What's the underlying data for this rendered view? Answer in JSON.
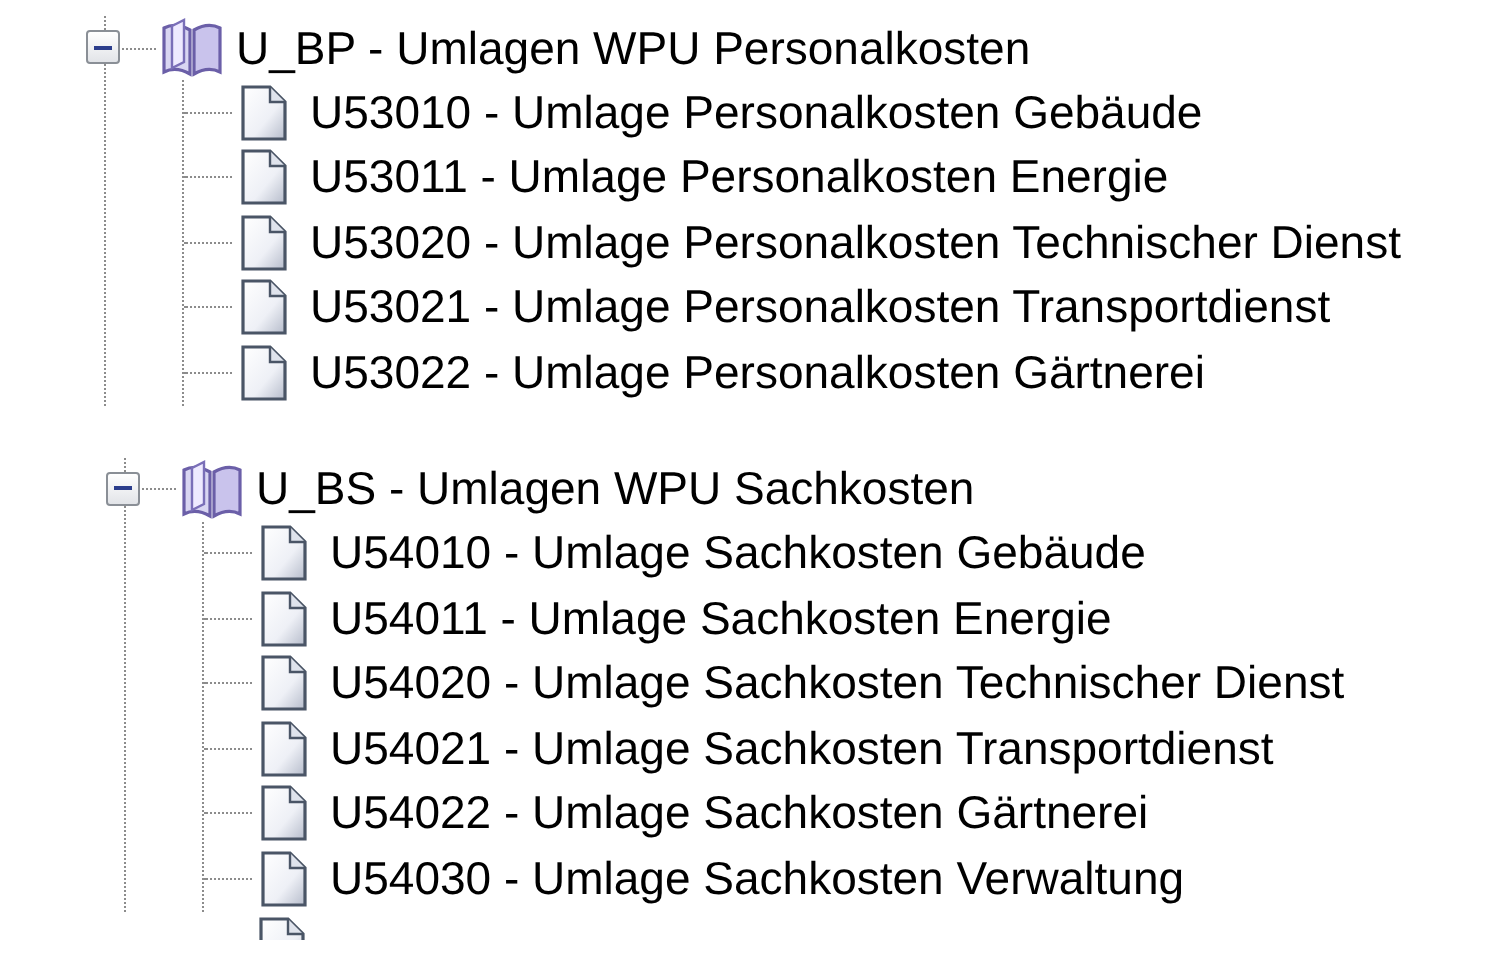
{
  "tree": [
    {
      "label": "U_BP - Umlagen WPU Personalkosten",
      "expanded": true,
      "more_below": false,
      "children": [
        {
          "label": "U53010 - Umlage Personalkosten Gebäude"
        },
        {
          "label": "U53011 - Umlage Personalkosten Energie"
        },
        {
          "label": "U53020 - Umlage Personalkosten Technischer Dienst"
        },
        {
          "label": "U53021 - Umlage Personalkosten Transportdienst"
        },
        {
          "label": "U53022 - Umlage Personalkosten Gärtnerei"
        }
      ]
    },
    {
      "label": "U_BS - Umlagen WPU Sachkosten",
      "expanded": true,
      "more_below": true,
      "children": [
        {
          "label": "U54010 - Umlage Sachkosten Gebäude"
        },
        {
          "label": "U54011 - Umlage Sachkosten Energie"
        },
        {
          "label": "U54020 - Umlage Sachkosten Technischer Dienst"
        },
        {
          "label": "U54021 - Umlage Sachkosten Transportdienst"
        },
        {
          "label": "U54022 - Umlage Sachkosten Gärtnerei"
        },
        {
          "label": "U54030 - Umlage Sachkosten Verwaltung"
        }
      ]
    }
  ]
}
